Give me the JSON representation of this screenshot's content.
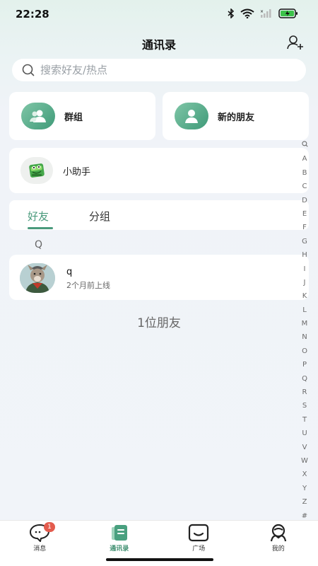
{
  "status_bar": {
    "time": "22:28"
  },
  "header": {
    "title": "通讯录"
  },
  "search": {
    "placeholder": "搜索好友/热点"
  },
  "cards": {
    "group_label": "群组",
    "new_friends_label": "新的朋友",
    "assistant_label": "小助手"
  },
  "tabs": [
    {
      "label": "好友",
      "active": true
    },
    {
      "label": "分组",
      "active": false
    }
  ],
  "section_letter": "Q",
  "friends": [
    {
      "name": "q",
      "status": "2个月前上线"
    }
  ],
  "friend_count": "1位朋友",
  "alpha_index": [
    "A",
    "B",
    "C",
    "D",
    "E",
    "F",
    "G",
    "H",
    "I",
    "J",
    "K",
    "L",
    "M",
    "N",
    "O",
    "P",
    "Q",
    "R",
    "S",
    "T",
    "U",
    "V",
    "W",
    "X",
    "Y",
    "Z",
    "#"
  ],
  "tabbar": {
    "items": [
      {
        "label": "消息",
        "icon": "chat-bubble-icon",
        "badge": "1"
      },
      {
        "label": "通讯录",
        "icon": "contacts-icon",
        "active": true
      },
      {
        "label": "广场",
        "icon": "square-icon"
      },
      {
        "label": "我的",
        "icon": "profile-icon"
      }
    ]
  },
  "colors": {
    "accent": "#4a9a7c",
    "badge": "#e35b4d"
  }
}
